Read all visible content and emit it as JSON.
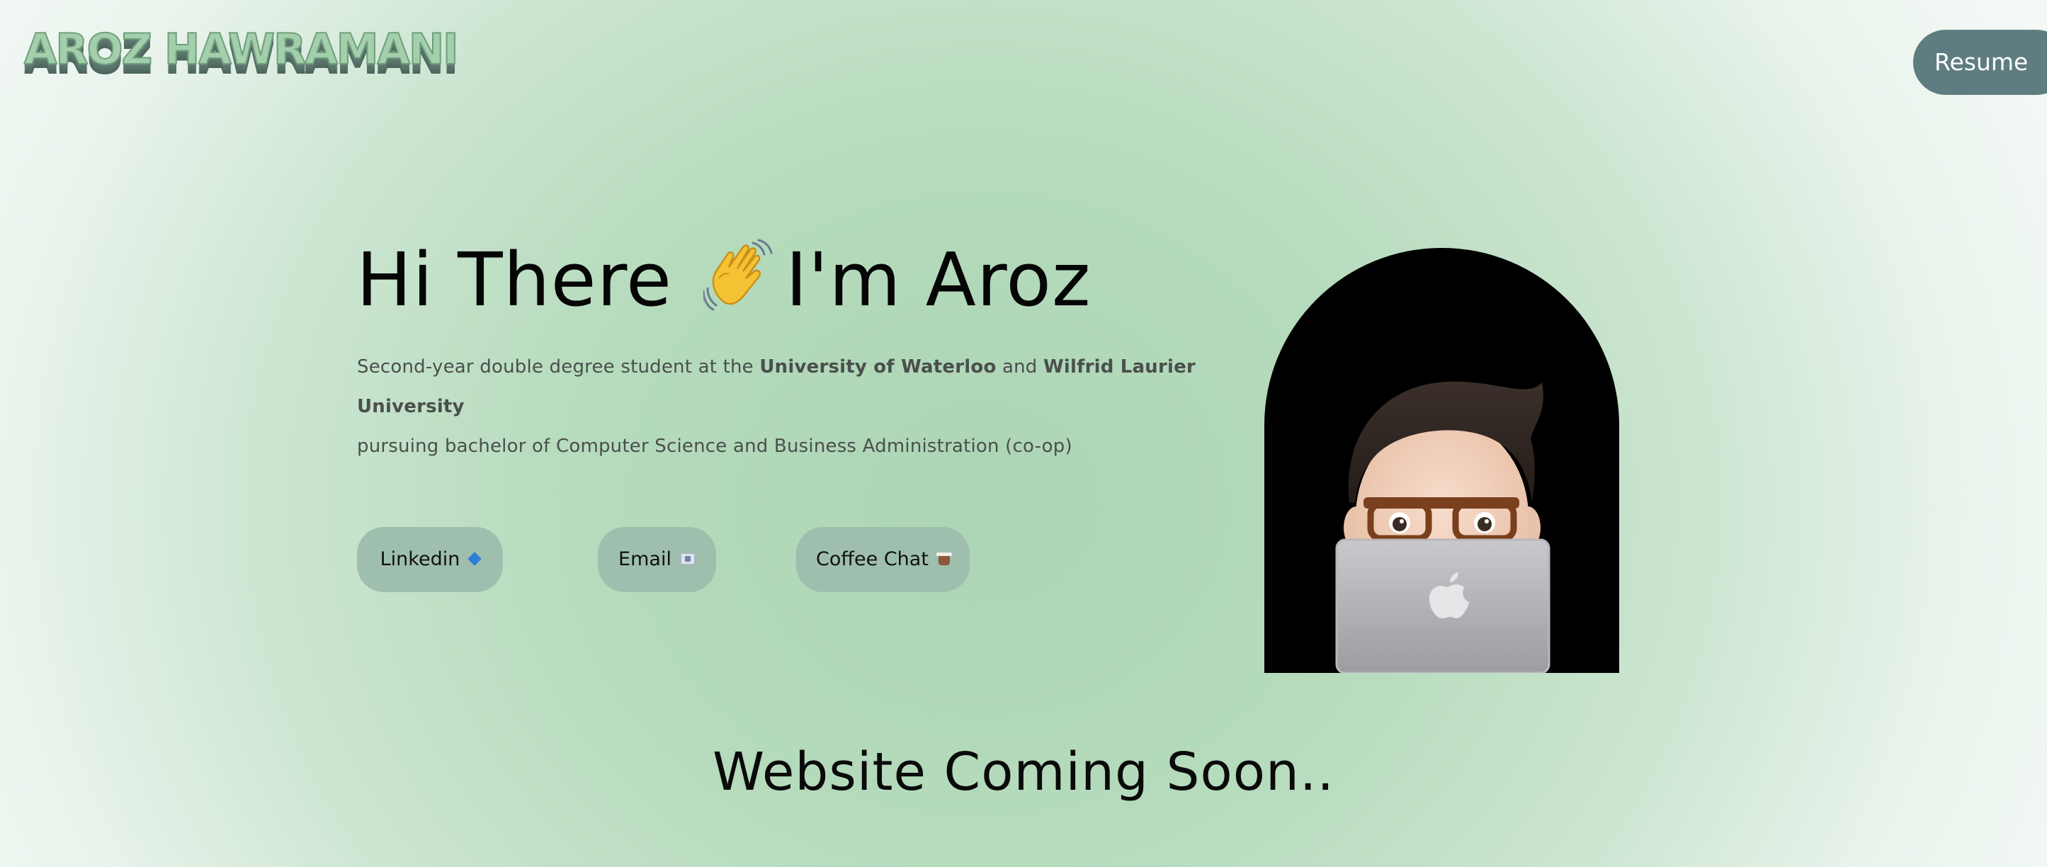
{
  "header": {
    "logo_text": "AROZ HAWRAMANI",
    "resume_label": "Resume"
  },
  "hero": {
    "greeting": "Hi There",
    "greeting_name": "I'm Aroz",
    "wave_icon": "waving-hand-emoji",
    "description": {
      "part1": "Second-year double degree student at the ",
      "school1": "University of Waterloo",
      "part2": " and ",
      "school2": "Wilfrid Laurier University",
      "part3": "pursuing bachelor of Computer Science and Business Administration (co-op)"
    }
  },
  "links": [
    {
      "label": "Linkedin",
      "icon": "blue-diamond-emoji"
    },
    {
      "label": "Email",
      "icon": "id-card-emoji"
    },
    {
      "label": "Coffee Chat",
      "icon": "coffee-emoji"
    }
  ],
  "avatar": {
    "icon": "memoji-with-laptop"
  },
  "footer": {
    "coming_soon": "Website Coming Soon.."
  },
  "colors": {
    "background_center": "#acd5b5",
    "resume_button": "#5f7d80",
    "pill_button": "#9ebfae",
    "avatar_background": "#000000"
  }
}
